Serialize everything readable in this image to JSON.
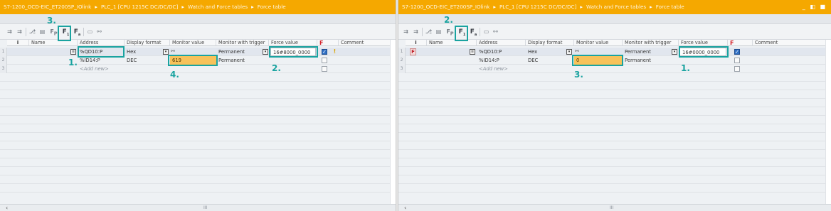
{
  "left": {
    "breadcrumb": [
      "S7-1200_OCD-EIC_ET200SP_IOlink",
      "PLC_1 [CPU 1215C DC/DC/DC]",
      "Watch and Force tables",
      "Force table"
    ],
    "columns": {
      "info": "i",
      "name": "Name",
      "address": "Address",
      "display_format": "Display format",
      "monitor_value": "Monitor value",
      "monitor_trigger": "Monitor with trigger",
      "force_value": "Force value",
      "force_flag": "F",
      "comment": "Comment"
    },
    "rows": [
      {
        "num": "1",
        "address": "%QD10:P",
        "format": "Hex",
        "monitor": "",
        "trigger": "Permanent",
        "force": "16#8000_0000",
        "forced": true,
        "warning": true
      },
      {
        "num": "2",
        "address": "%ID14:P",
        "format": "DEC",
        "monitor": "619",
        "trigger": "Permanent",
        "force": "",
        "forced": false,
        "warning": false
      },
      {
        "num": "3",
        "address": "<Add new>",
        "format": "",
        "monitor": "",
        "trigger": "",
        "force": "",
        "forced": false,
        "warning": false
      }
    ],
    "markers": [
      "1.",
      "2.",
      "3.",
      "4."
    ],
    "scroll_thumb": "III"
  },
  "right": {
    "breadcrumb": [
      "S7-1200_OCD-EIC_ET200SP_IOlink",
      "PLC_1 [CPU 1215C DC/DC/DC]",
      "Watch and Force tables",
      "Force table"
    ],
    "columns": {
      "info": "i",
      "name": "Name",
      "address": "Address",
      "display_format": "Display format",
      "monitor_value": "Monitor value",
      "monitor_trigger": "Monitor with trigger",
      "force_value": "Force value",
      "force_flag": "F",
      "comment": "Comment"
    },
    "rows": [
      {
        "num": "1",
        "address": "%QD10:P",
        "format": "Hex",
        "monitor": "",
        "trigger": "Permanent",
        "force": "16#0000_0000",
        "forced": true
      },
      {
        "num": "2",
        "address": "%ID14:P",
        "format": "DEC",
        "monitor": "0",
        "trigger": "Permanent",
        "force": "",
        "forced": false
      },
      {
        "num": "3",
        "address": "<Add new>",
        "format": "",
        "monitor": "",
        "trigger": "",
        "force": "",
        "forced": false
      }
    ],
    "row_flag": "F",
    "markers": [
      "1.",
      "2.",
      "3."
    ],
    "window_controls": "_ ◧ ■",
    "scroll_thumb": "III"
  },
  "toolbar_icons": {
    "force_icon": "F",
    "force_sub": "1",
    "force_all": "F",
    "force_all_sub": "a",
    "f_plain": "F",
    "f_plain_sub": "P"
  },
  "colors": {
    "title_bar": "#f5a800",
    "highlight": "#1aa3a0",
    "monitor_bg": "#f7c25a",
    "force_flag": "#d4232c"
  }
}
